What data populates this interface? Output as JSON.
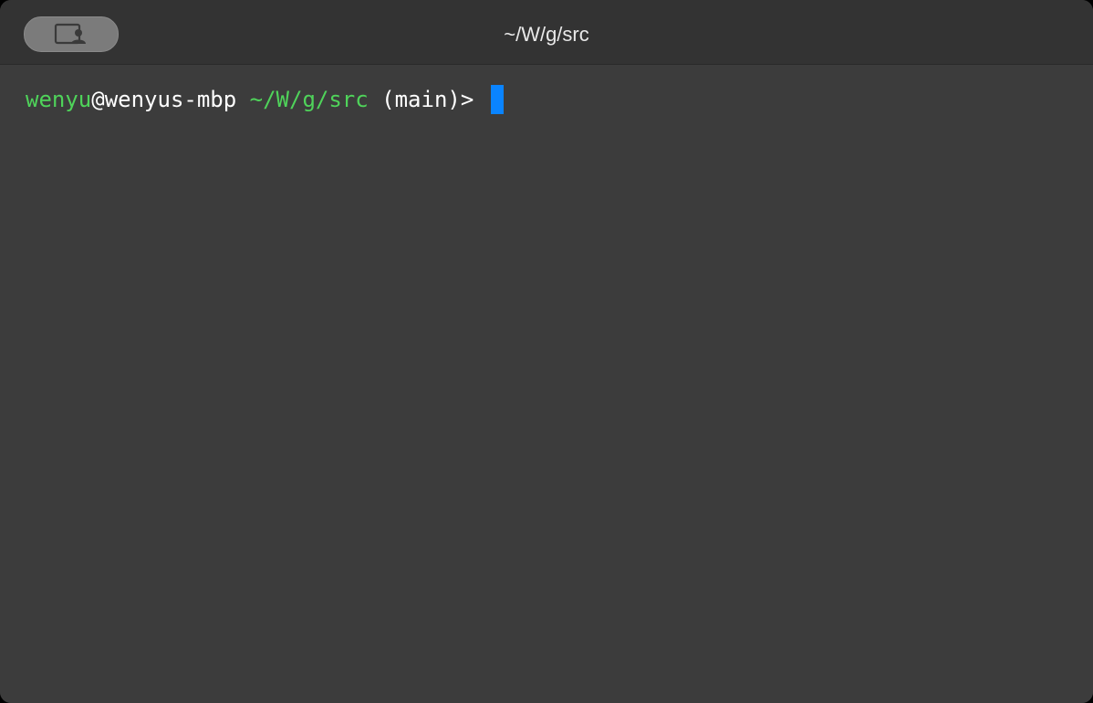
{
  "window": {
    "title": "~/W/g/src"
  },
  "titlebar": {
    "profile_button_icon": "profile-icon"
  },
  "terminal": {
    "prompt": {
      "user": "wenyu",
      "at_host": "@wenyus-mbp",
      "path": "~/W/g/src",
      "branch": "(main)>",
      "input": ""
    }
  },
  "colors": {
    "window_bg": "#3c3c3c",
    "titlebar_bg": "#333333",
    "prompt_green": "#4fd35a",
    "cursor_blue": "#0a84ff"
  }
}
